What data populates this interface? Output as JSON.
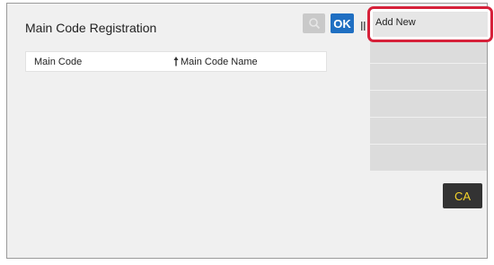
{
  "window": {
    "title": "Main Code Registration"
  },
  "toolbar": {
    "search_icon": "search-icon",
    "ok_label": "OK"
  },
  "table": {
    "headers": [
      "Main Code",
      "Main Code Name"
    ],
    "sort_icon": "sort-arrow-icon"
  },
  "menu": {
    "add_new_label": "Add New",
    "empty_items": 5,
    "highlight_color": "#d6213a"
  },
  "actions": {
    "ca_label": "CA",
    "ca_color": "#f4d42a"
  },
  "colors": {
    "ok_button": "#1f6fc2",
    "background": "#f0f0f0",
    "menu_item": "#dcdcdc"
  }
}
